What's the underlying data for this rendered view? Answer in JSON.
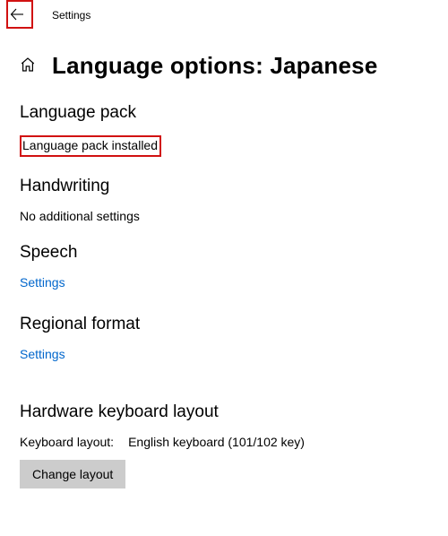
{
  "window": {
    "title": "Settings"
  },
  "page": {
    "title": "Language options: Japanese"
  },
  "sections": {
    "language_pack": {
      "heading": "Language pack",
      "status": "Language pack installed"
    },
    "handwriting": {
      "heading": "Handwriting",
      "status": "No additional settings"
    },
    "speech": {
      "heading": "Speech",
      "link": "Settings"
    },
    "regional": {
      "heading": "Regional format",
      "link": "Settings"
    },
    "hardware_kb": {
      "heading": "Hardware keyboard layout",
      "label": "Keyboard layout:",
      "value": "English keyboard (101/102 key)",
      "button": "Change layout"
    }
  }
}
